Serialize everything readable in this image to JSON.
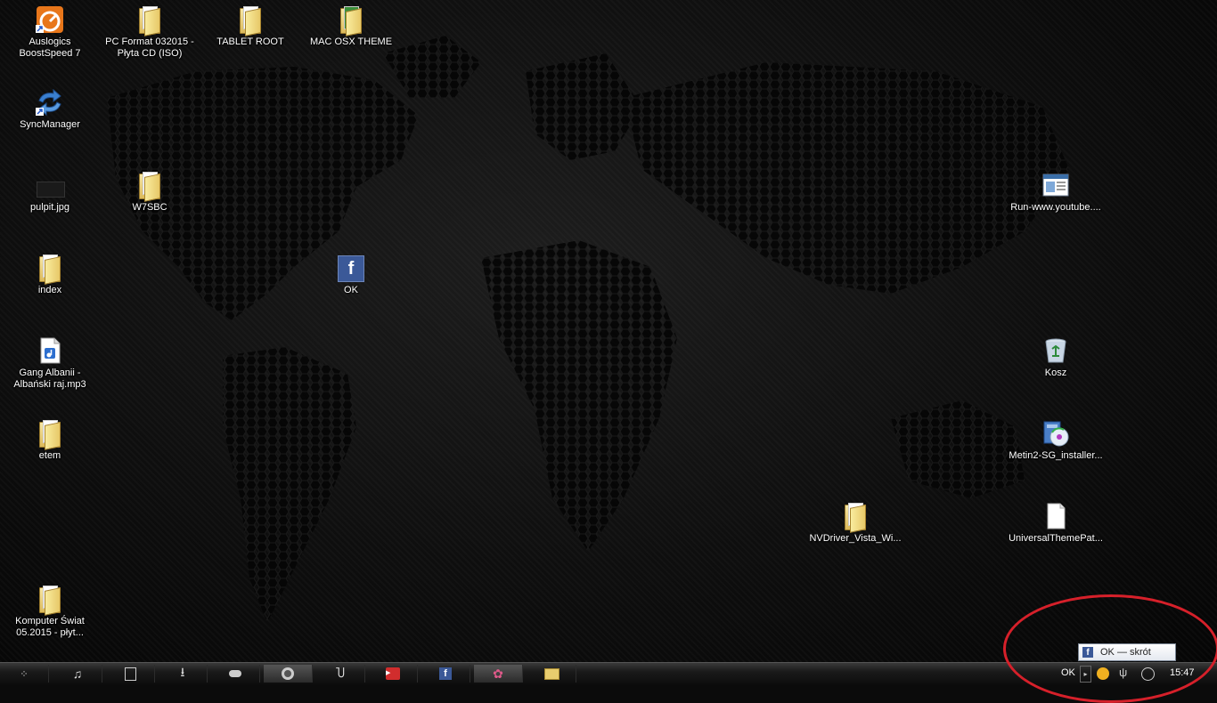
{
  "desktop_icons": [
    {
      "id": "auslogics",
      "label": "Auslogics\nBoostSpeed 7",
      "icon": "boostspeed-icon"
    },
    {
      "id": "pcformat",
      "label": "PC Format 032015 -\nPłyta CD (ISO)",
      "icon": "folder-icon"
    },
    {
      "id": "tabletroot",
      "label": "TABLET ROOT",
      "icon": "folder-icon"
    },
    {
      "id": "macosx",
      "label": "MAC OSX THEME",
      "icon": "folder-icon"
    },
    {
      "id": "syncmanager",
      "label": "SyncManager",
      "icon": "sync-icon"
    },
    {
      "id": "pulpit",
      "label": "pulpit.jpg",
      "icon": "image-thumbnail-icon"
    },
    {
      "id": "w7sbc",
      "label": "W7SBC",
      "icon": "folder-icon"
    },
    {
      "id": "index",
      "label": "index",
      "icon": "folder-icon"
    },
    {
      "id": "ok",
      "label": "OK",
      "icon": "facebook-icon"
    },
    {
      "id": "gangalbanii",
      "label": "Gang Albanii -\nAlbański raj.mp3",
      "icon": "audio-file-icon"
    },
    {
      "id": "etem",
      "label": "etem",
      "icon": "folder-icon"
    },
    {
      "id": "komputerswiat",
      "label": "Komputer Świat\n05.2015 - płyt...",
      "icon": "folder-icon"
    },
    {
      "id": "runyoutube",
      "label": "Run-www.youtube....",
      "icon": "shortcut-window-icon"
    },
    {
      "id": "kosz",
      "label": "Kosz",
      "icon": "recycle-bin-icon"
    },
    {
      "id": "metin2",
      "label": "Metin2-SG_installer...",
      "icon": "installer-icon"
    },
    {
      "id": "nvdriver",
      "label": "NVDriver_Vista_Wi...",
      "icon": "folder-icon"
    },
    {
      "id": "universaltheme",
      "label": "UniversalThemePat...",
      "icon": "blank-file-icon"
    }
  ],
  "taskbar": {
    "tray_label": "OK",
    "clock": "15:47",
    "tooltip": "OK — skrót",
    "fb_glyph": "f"
  },
  "colors": {
    "highlight": "#d6202a",
    "facebook": "#3b5998"
  }
}
